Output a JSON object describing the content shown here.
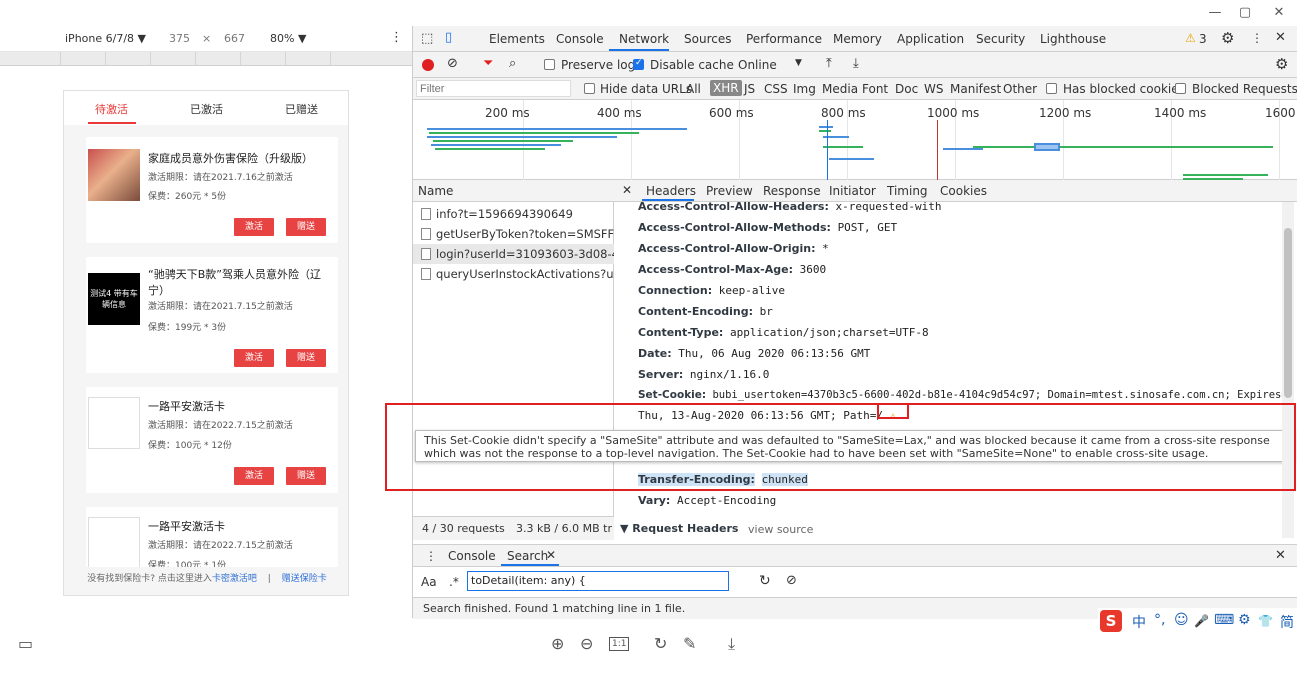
{
  "window": {
    "minimize": "—",
    "restore": "▢",
    "close": "✕"
  },
  "device_toolbar": {
    "device": "iPhone 6/7/8 ▼",
    "width": "375",
    "times": "×",
    "height": "667",
    "zoom": "80% ▼",
    "more": "⋮"
  },
  "phone": {
    "tabs": [
      "待激活",
      "已激活",
      "已赠送"
    ],
    "cards": [
      {
        "title": "家庭成员意外伤害保险（升级版）",
        "period": "激活期限：请在2021.7.16之前激活",
        "premium": "保费：260元 * 5份",
        "activate": "激活",
        "gift": "赠送"
      },
      {
        "title": "“驰骋天下B款”驾乘人员意外险（辽宁）",
        "thumb_text": "测试4 带有车辆信息",
        "period": "激活期限：请在2021.7.15之前激活",
        "premium": "保费：199元 * 3份",
        "activate": "激活",
        "gift": "赠送"
      },
      {
        "title": "一路平安激活卡",
        "period": "激活期限：请在2022.7.15之前激活",
        "premium": "保费：100元 * 12份",
        "activate": "激活",
        "gift": "赠送"
      },
      {
        "title": "一路平安激活卡",
        "period": "激活期限：请在2022.7.15之前激活",
        "premium": "保费：100元 * 1份"
      }
    ],
    "footer_text": "没有找到保险卡? 点击这里进入",
    "footer_link1": "卡密激活吧",
    "footer_sep": "|",
    "footer_link2": "赠送保险卡"
  },
  "devtools": {
    "tabs": [
      "Elements",
      "Console",
      "Network",
      "Sources",
      "Performance",
      "Memory",
      "Application",
      "Security",
      "Lighthouse"
    ],
    "active_tab": "Network",
    "warning_count": "3",
    "net_toolbar": {
      "preserve_log": "Preserve log",
      "disable_cache": "Disable cache",
      "throttle": "Online",
      "throttle_arrow": "▼"
    },
    "filter": {
      "placeholder": "Filter",
      "hide_data_urls": "Hide data URLs",
      "types": [
        "All",
        "XHR",
        "JS",
        "CSS",
        "Img",
        "Media",
        "Font",
        "Doc",
        "WS",
        "Manifest",
        "Other"
      ],
      "active_type": "XHR",
      "has_blocked_cookies": "Has blocked cookies",
      "blocked_requests": "Blocked Requests"
    },
    "timeline_labels": [
      "200 ms",
      "400 ms",
      "600 ms",
      "800 ms",
      "1000 ms",
      "1200 ms",
      "1400 ms",
      "1600"
    ],
    "name_header": "Name",
    "requests": [
      "info?t=1596694390649",
      "getUserByToken?token=SMSFF1...",
      "login?userId=31093603-3d08-45...",
      "queryUserInstockActivations?use..."
    ],
    "requests_summary": "4 / 30 requests",
    "transfer_summary": "3.3 kB / 6.0 MB tran",
    "detail_tabs": [
      "Headers",
      "Preview",
      "Response",
      "Initiator",
      "Timing",
      "Cookies"
    ],
    "headers": [
      {
        "key": "Access-Control-Allow-Headers:",
        "value": "x-requested-with"
      },
      {
        "key": "Access-Control-Allow-Methods:",
        "value": "POST, GET"
      },
      {
        "key": "Access-Control-Allow-Origin:",
        "value": "*"
      },
      {
        "key": "Access-Control-Max-Age:",
        "value": "3600"
      },
      {
        "key": "Connection:",
        "value": "keep-alive"
      },
      {
        "key": "Content-Encoding:",
        "value": "br"
      },
      {
        "key": "Content-Type:",
        "value": "application/json;charset=UTF-8"
      },
      {
        "key": "Date:",
        "value": "Thu, 06 Aug 2020 06:13:56 GMT"
      },
      {
        "key": "Server:",
        "value": "nginx/1.16.0"
      },
      {
        "key": "Set-Cookie:",
        "value": "bubi_usertoken=4370b3c5-6600-402d-b81e-4104c9d54c97; Domain=mtest.sinosafe.com.cn; Expires="
      }
    ],
    "set_cookie_cont": "Thu, 13-Aug-2020 06:13:56 GMT; Path=/",
    "tooltip": "This Set-Cookie didn't specify a \"SameSite\" attribute and was defaulted to \"SameSite=Lax,\" and was blocked because it came from a cross-site response which was not the response to a top-level navigation. The Set-Cookie had to have been set with \"SameSite=None\" to enable cross-site usage.",
    "transfer_encoding_key": "Transfer-Encoding:",
    "transfer_encoding_value": "chunked",
    "vary_key": "Vary:",
    "vary_value": "Accept-Encoding",
    "request_headers": "▼ Request Headers",
    "view_source": "view source",
    "drawer": {
      "tabs": [
        "Console",
        "Search"
      ],
      "aa": "Aa",
      "regex": ".*",
      "search_value": "toDetail(item: any) {",
      "status": "Search finished.  Found 1 matching line in 1 file."
    }
  },
  "ime": {
    "logo": "S",
    "items": [
      "中",
      "°,",
      "☺",
      "🎤",
      "⌨",
      "⚙",
      "👕",
      "简"
    ]
  },
  "colors": {
    "accent": "#1a73e8",
    "phone_red": "#e83a3a",
    "highlight_box": "#e02020"
  }
}
